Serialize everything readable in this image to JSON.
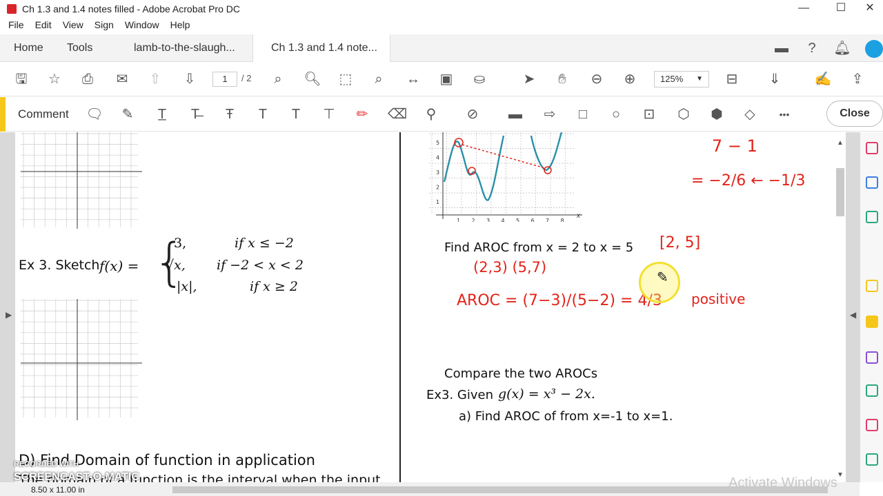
{
  "window": {
    "title": "Ch 1.3 and 1.4 notes filled - Adobe Acrobat Pro DC",
    "minimize": "—",
    "maximize": "☐",
    "close": "✕"
  },
  "menu": [
    "File",
    "Edit",
    "View",
    "Sign",
    "Window",
    "Help"
  ],
  "tabs": {
    "home": "Home",
    "tools": "Tools",
    "doc1": "lamb-to-the-slaugh...",
    "doc2": "Ch 1.3 and 1.4 note...",
    "doc2_close": "✕"
  },
  "toolbar": {
    "page_current": "1",
    "page_total": "/ 2",
    "zoom": "125%"
  },
  "comment_bar": {
    "label": "Comment",
    "close": "Close",
    "more": "•••"
  },
  "document": {
    "left": {
      "ex3_label": "Ex 3. Sketch",
      "ex3_fn": "f(x) =",
      "piece1_val": "3,",
      "piece1_cond": "if x ≤ −2",
      "piece2_val": "√x,",
      "piece2_cond": "if −2 < x < 2",
      "piece3_val": "|x|,",
      "piece3_cond": "if x ≥ 2",
      "section_d": "D) Find Domain of function in application",
      "section_d_body": "The domain of a function is the interval when the input"
    },
    "right": {
      "find_aroc": "Find AROC from x = 2 to x = 5",
      "compare": "Compare the two AROCs",
      "ex3_given": "Ex3. Given",
      "ex3_fn": "g(x) = x³ − 2x.",
      "part_a": "a) Find  AROC of from x=-1 to x=1."
    },
    "handwriting": {
      "top1": "7 − 1",
      "top2": "= −2/6 ← −1/3",
      "interval": "[2, 5]",
      "points": "(2,3)  (5,7)",
      "aroc": "AROC = (7−3)/(5−2) = 4/3",
      "positive": "positive"
    },
    "graph_ticks_y": [
      "5",
      "4",
      "3",
      "2",
      "1"
    ],
    "graph_ticks_x": [
      "1",
      "2",
      "3",
      "4",
      "5",
      "6",
      "7",
      "8"
    ]
  },
  "status": {
    "page_size": "8.50 x 11.00 in",
    "watermark": "Activate Windows",
    "recorded": "RECORDED WITH",
    "screencast": "SCREENCAST-O-MATIC"
  },
  "colors": {
    "accent_yellow": "#f5c71a",
    "ink_red": "#e2231a",
    "curve_teal": "#2a8fa8"
  }
}
